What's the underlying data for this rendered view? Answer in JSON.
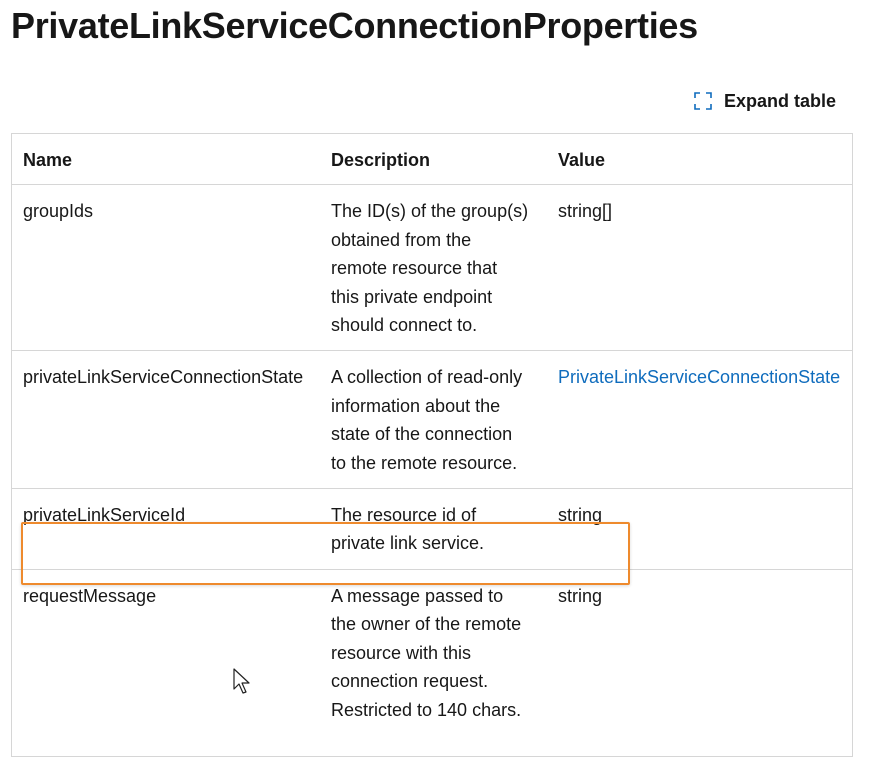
{
  "page": {
    "title": "PrivateLinkServiceConnectionProperties"
  },
  "toolbar": {
    "expand_label": "Expand table",
    "expand_icon": "expand-icon"
  },
  "table": {
    "headers": {
      "name": "Name",
      "description": "Description",
      "value": "Value"
    },
    "rows": [
      {
        "name": "groupIds",
        "description": "The ID(s) of the group(s) obtained from the remote resource that this private endpoint should connect to.",
        "value": "string[]"
      },
      {
        "name": "privateLinkServiceConnectionState",
        "description": "A collection of read-only information about the state of the connection to the remote resource.",
        "value": "PrivateLinkServiceConnectionState"
      },
      {
        "name": "privateLinkServiceId",
        "description": "The resource id of private link service.",
        "value": "string"
      },
      {
        "name": "requestMessage",
        "description": "A message passed to the owner of the remote resource with this connection request. Restricted to 140 chars.",
        "value": "string"
      }
    ]
  },
  "colors": {
    "link": "#0f6cbd",
    "highlight": "#ee8a2d",
    "border": "#d6d6d6",
    "text": "#171717"
  }
}
